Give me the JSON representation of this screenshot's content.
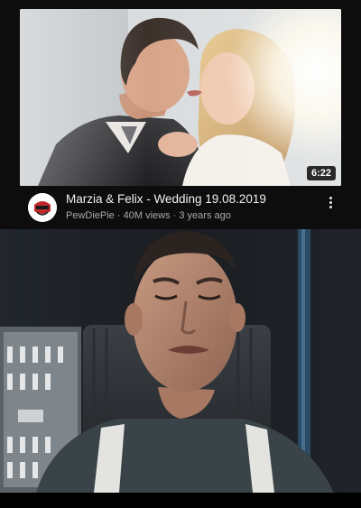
{
  "video": {
    "title": "Marzia & Felix - Wedding 19.08.2019",
    "channel": "PewDiePie",
    "views": "40M views",
    "age": "3 years ago",
    "separator": "·",
    "duration": "6:22"
  },
  "icons": {
    "more": "vertical-ellipsis-icon",
    "avatar": "channel-avatar"
  }
}
